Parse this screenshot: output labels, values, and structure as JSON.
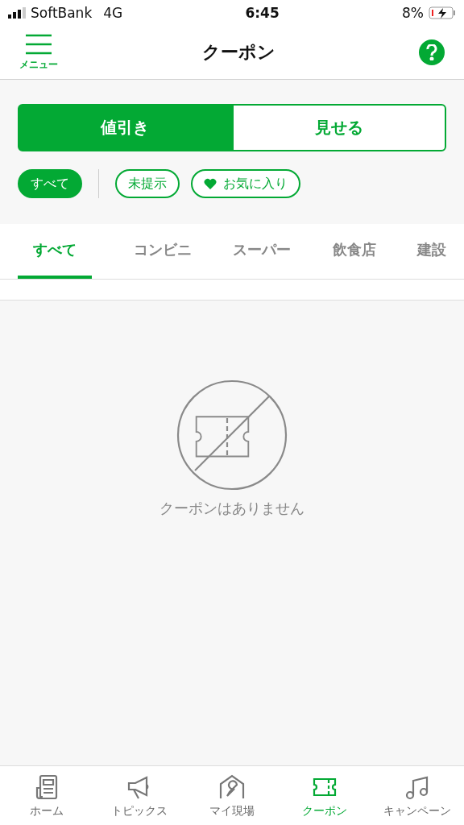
{
  "status_bar": {
    "carrier": "SoftBank",
    "network": "4G",
    "time": "6:45",
    "battery": "8%"
  },
  "header": {
    "menu_label": "メニュー",
    "title": "クーポン"
  },
  "segments": [
    {
      "label": "値引き",
      "selected": true
    },
    {
      "label": "見せる",
      "selected": false
    }
  ],
  "filters": [
    {
      "label": "すべて",
      "selected": true,
      "kind": "plain"
    },
    {
      "label": "未提示",
      "selected": false,
      "kind": "plain"
    },
    {
      "label": "お気に入り",
      "selected": false,
      "kind": "favorite"
    }
  ],
  "category_tabs": [
    {
      "label": "すべて",
      "selected": true
    },
    {
      "label": "コンビニ",
      "selected": false
    },
    {
      "label": "スーパー",
      "selected": false
    },
    {
      "label": "飲食店",
      "selected": false
    },
    {
      "label": "建設",
      "selected": false
    }
  ],
  "empty_message": "クーポンはありません",
  "bottom_nav": [
    {
      "label": "ホーム",
      "kind": "news",
      "selected": false
    },
    {
      "label": "トピックス",
      "kind": "megaphone",
      "selected": false
    },
    {
      "label": "マイ現場",
      "kind": "house",
      "selected": false
    },
    {
      "label": "クーポン",
      "kind": "ticket",
      "selected": true
    },
    {
      "label": "キャンペーン",
      "kind": "music",
      "selected": false
    }
  ]
}
